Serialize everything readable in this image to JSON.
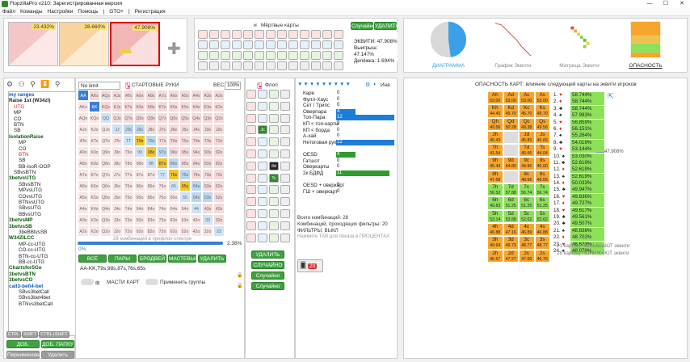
{
  "app": {
    "title": "FlopzillaPro v210: Зарегистрированная версия",
    "min": "—",
    "max": "☐",
    "close": "✕"
  },
  "menu": {
    "items": [
      "Файл",
      "Команды",
      "Настройки",
      "Помощь",
      "|",
      "GTO+",
      "|",
      "Регистрация"
    ]
  },
  "thumbs": [
    {
      "pct": "23.432%"
    },
    {
      "pct": "28.660%"
    },
    {
      "pct": "47.908%"
    }
  ],
  "top_deck": {
    "title": "Мёртвые карты",
    "random_label": "Случайно",
    "delete_label": "УДАЛИТЬ"
  },
  "equity": {
    "line1": "ЭКВИТИ: 47.908%",
    "line2": "Выигрыш: 47.147%",
    "line3": "Делёжка: 1.694%"
  },
  "tabs": [
    {
      "label": "ДИАГРАММА"
    },
    {
      "label": "График Эквити"
    },
    {
      "label": "Матрица Эквити"
    },
    {
      "label": "ОПАСНОСТЬ"
    }
  ],
  "pie": {
    "value": 0.47908,
    "color": "#3aa0e8"
  },
  "range_panel": {
    "mode_select": "No limit",
    "start_hands_label": "СТАРТОВЫЕ РУКИ",
    "weight_label": "ВЕС:",
    "weight_value": "100%",
    "combo_note": "28 комбинаций в префлоп-спектре",
    "pct_low": "0%",
    "pct_high": "2.38%",
    "buttons": [
      "ВСЁ",
      "ПАРЫ",
      "БРОДВЕЙ",
      "МАСТЕВЫЕ",
      "УДАЛИТЬ"
    ],
    "range_text": "AA-KK,T9s,98s,87s,76s,65s",
    "suits_label": "МАСТИ КАРТ",
    "apply_groups_label": "Применить группы"
  },
  "hand_grid": {
    "ranks": [
      "A",
      "K",
      "Q",
      "J",
      "T",
      "9",
      "8",
      "7",
      "6",
      "5",
      "4",
      "3",
      "2"
    ],
    "selected": [
      "AA",
      "KK",
      "T9s",
      "98s",
      "87s",
      "76s",
      "65s"
    ]
  },
  "tree": {
    "items": [
      {
        "t": "my ranges",
        "s": "head-blue"
      },
      {
        "t": "Raise 1st (W34zl)",
        "s": "bold"
      },
      {
        "t": "UTG",
        "s": "red",
        "i": 1
      },
      {
        "t": "MP",
        "s": "",
        "i": 1
      },
      {
        "t": "CO",
        "s": "",
        "i": 1
      },
      {
        "t": "BTN",
        "s": "",
        "i": 1
      },
      {
        "t": "SB",
        "s": "",
        "i": 1
      },
      {
        "t": "IsolationRaise",
        "s": "head"
      },
      {
        "t": "MP",
        "s": "",
        "i": 2
      },
      {
        "t": "CO",
        "s": "",
        "i": 2
      },
      {
        "t": "BTN",
        "s": "red",
        "i": 2
      },
      {
        "t": "SB",
        "s": "",
        "i": 2
      },
      {
        "t": "BB-IsoR-OOP",
        "s": "",
        "i": 2
      },
      {
        "t": "SBvsBTN",
        "s": "",
        "i": 1
      },
      {
        "t": "3betvsUTG",
        "s": "head"
      },
      {
        "t": "SBvsBTN",
        "s": "",
        "i": 2
      },
      {
        "t": "MPvsUTG",
        "s": "",
        "i": 2
      },
      {
        "t": "COvsUTG",
        "s": "",
        "i": 2
      },
      {
        "t": "BTNvsUTG",
        "s": "",
        "i": 2
      },
      {
        "t": "SBvsUTG",
        "s": "",
        "i": 2
      },
      {
        "t": "BBvsUTG",
        "s": "",
        "i": 2
      },
      {
        "t": "3betvsMP",
        "s": "head"
      },
      {
        "t": "3betvsSB",
        "s": "head"
      },
      {
        "t": "3beBBtvsSB",
        "s": "",
        "i": 2
      },
      {
        "t": "W34ZlLCC",
        "s": "head"
      },
      {
        "t": "MP-cc-UTG",
        "s": "",
        "i": 2
      },
      {
        "t": "CO-cc-UTG",
        "s": "",
        "i": 2
      },
      {
        "t": "BTN-cc-UTG",
        "s": "",
        "i": 2
      },
      {
        "t": "BB-cc-UTG",
        "s": "",
        "i": 2
      },
      {
        "t": "Chartsfor5Go",
        "s": "head"
      },
      {
        "t": "3betvsBTN",
        "s": "head"
      },
      {
        "t": "3betvsCO",
        "s": "head"
      },
      {
        "t": "call3-bet\\4-bet",
        "s": "head-blue"
      },
      {
        "t": "SBvs3betCall",
        "s": "",
        "i": 2
      },
      {
        "t": "SBvs3bet4bet",
        "s": "",
        "i": 2
      },
      {
        "t": "BTNvs3betCall",
        "s": "",
        "i": 2
      }
    ],
    "ctrl": [
      "CTRL",
      "SHIFT",
      "CTRL+SHIFT"
    ],
    "add_range": "ДОБ. СПЕКТР",
    "add_folder": "ДОБ. ПАПКУ",
    "rename": "Переименовать",
    "delete": "Удалить"
  },
  "flop": {
    "title": "Флоп",
    "inv": "Инв",
    "board": [
      "Jc",
      "8d",
      "Tc"
    ]
  },
  "flop_buttons": {
    "delete": "УДАЛИТЬ",
    "random": "СЛУЧАЙНО",
    "random_t": "Случайно (T)",
    "random_r": "Случайно (R)"
  },
  "stats": {
    "rows": [
      {
        "l": "Каре",
        "v": "0"
      },
      {
        "l": "Фулл-Хаус",
        "v": "0"
      },
      {
        "l": "Сет / Трипс",
        "v": "0"
      },
      {
        "l": "Оверпара",
        "v": "4",
        "bar": "b"
      },
      {
        "l": "Топ-Пара",
        "v": "12",
        "bar": "b"
      },
      {
        "l": "КП < топ-карты",
        "v": "0"
      },
      {
        "l": "КП < борда",
        "v": "0"
      },
      {
        "l": "А-хай",
        "v": "0"
      },
      {
        "l": "Нетоговая рука",
        "v": "12",
        "bar": "b"
      },
      {
        "l": "",
        "v": ""
      },
      {
        "l": "OESD",
        "v": "4",
        "bar": "g"
      },
      {
        "l": "Гатшот",
        "v": "0"
      },
      {
        "l": "Оверкарты",
        "v": "0"
      },
      {
        "l": "2к БДФД",
        "v": "11",
        "bar": "g"
      },
      {
        "l": "",
        "v": ""
      },
      {
        "l": "OESD + оверкарт",
        "v": "0"
      },
      {
        "l": "ГШ + оверкарт",
        "v": "0"
      }
    ],
    "total": "Всего комбинаций: 28",
    "passed": "Комбинаций, проходящих фильтры: 20",
    "filters": "ФИЛЬТРЫ: ВЫКЛ",
    "hint": "Нажмите TAB для показа в ПРОЦЕНТАХ",
    "badge": "20"
  },
  "danger": {
    "title": "ОПАСНОСТЬ КАРТ: влияние следующей карты на эквити игроков",
    "up": "21 карт(ы) ПОВЫШАЮТ эквити",
    "down": "28 карт(ы) ПОНИЖАЮТ эквити",
    "line_value": "47.908%"
  },
  "danger_grid": [
    [
      "Ah",
      "Ad",
      "Ac",
      "As"
    ],
    [
      "Kh",
      "Kd",
      "Kc",
      "Ks"
    ],
    [
      "Qh",
      "Qd",
      "Qc",
      "Qs"
    ],
    [
      "Jh",
      "",
      "Jd",
      "Js"
    ],
    [
      "Th",
      "",
      "Td",
      "Ts"
    ],
    [
      "9h",
      "9d",
      "9c",
      "9s"
    ],
    [
      "8h",
      "",
      "8c",
      "8s"
    ],
    [
      "7h",
      "7d",
      "7c",
      "7s"
    ],
    [
      "6h",
      "6d",
      "6c",
      "6s"
    ],
    [
      "5h",
      "5d",
      "5c",
      "5s"
    ],
    [
      "4h",
      "4d",
      "4c",
      "4s"
    ],
    [
      "3h",
      "3d",
      "3c",
      "3s"
    ],
    [
      "2h",
      "2d",
      "2c",
      "2s"
    ]
  ],
  "danger_vals": [
    [
      "53.00",
      "53.00",
      "53.00",
      "53.00"
    ],
    [
      "44.40",
      "45.70",
      "45.70",
      "45.70"
    ],
    [
      "49.56",
      "50.28",
      "49.38",
      "49.56"
    ],
    [
      "45.43",
      "",
      "45.83",
      "45.83"
    ],
    [
      "41.54",
      "",
      "45.66",
      "44.04"
    ],
    [
      "45.43",
      "44.80",
      "44.96",
      "45.00"
    ],
    [
      "47.68",
      "",
      "48.66",
      "48.66"
    ],
    [
      "56.52",
      "57.88",
      "56.74",
      "56.74"
    ],
    [
      "49.83",
      "51.25",
      "51.25",
      "51.25"
    ],
    [
      "53.14",
      "53.88",
      "52.62",
      "52.62"
    ],
    [
      "46.88",
      "47.16",
      "46.89",
      "46.88"
    ],
    [
      "49.64",
      "49.73",
      "48.77",
      "48.77"
    ],
    [
      "46.67",
      "47.27",
      "47.00",
      "46.76"
    ]
  ],
  "danger_colors": [
    [
      "#f7a52e",
      "#f7a52e",
      "#f7a52e",
      "#f7a52e"
    ],
    [
      "#f7a52e",
      "#f7a52e",
      "#f7a52e",
      "#f7a52e"
    ],
    [
      "#f7a52e",
      "#f7a52e",
      "#f7a52e",
      "#f7a52e"
    ],
    [
      "#f7a52e",
      "#dddddd",
      "#f7a52e",
      "#f7a52e"
    ],
    [
      "#f7a52e",
      "#dddddd",
      "#f7a52e",
      "#f7a52e"
    ],
    [
      "#f7a52e",
      "#f7a52e",
      "#f7a52e",
      "#f7a52e"
    ],
    [
      "#f7a52e",
      "#dddddd",
      "#f7a52e",
      "#f7a52e"
    ],
    [
      "#8de05a",
      "#8de05a",
      "#8de05a",
      "#8de05a"
    ],
    [
      "#8de05a",
      "#8de05a",
      "#8de05a",
      "#8de05a"
    ],
    [
      "#8de05a",
      "#8de05a",
      "#8de05a",
      "#8de05a"
    ],
    [
      "#f7a52e",
      "#f7a52e",
      "#f7a52e",
      "#f7a52e"
    ],
    [
      "#f7a52e",
      "#f7a52e",
      "#f7a52e",
      "#f7a52e"
    ],
    [
      "#f7a52e",
      "#f7a52e",
      "#f7a52e",
      "#f7a52e"
    ]
  ],
  "ranking": [
    {
      "n": "1.",
      "c": "♥",
      "v": "58.744%",
      "col": "#8de05a"
    },
    {
      "n": "2.",
      "c": "♦",
      "v": "58.744%",
      "col": "#8de05a"
    },
    {
      "n": "3.",
      "c": "♣",
      "v": "58.744%",
      "col": "#8de05a"
    },
    {
      "n": "4.",
      "c": "♠",
      "v": "57.983%",
      "col": "#8de05a"
    },
    {
      "n": "5.",
      "c": "♥",
      "v": "56.859%",
      "col": "#8de05a"
    },
    {
      "n": "6.",
      "c": "♦",
      "v": "56.151%",
      "col": "#8de05a"
    },
    {
      "n": "7.",
      "c": "♠",
      "v": "55.264%",
      "col": "#8de05a"
    },
    {
      "n": "8.",
      "c": "♣",
      "v": "54.019%",
      "col": "#8de05a"
    },
    {
      "n": "9.",
      "c": "♥",
      "v": "53.144%",
      "col": "#8de05a"
    },
    {
      "n": "10.",
      "c": "♠",
      "v": "53.030%",
      "col": "#8de05a"
    },
    {
      "n": "11.",
      "c": "♣",
      "v": "52.619%",
      "col": "#8de05a"
    },
    {
      "n": "12.",
      "c": "♦",
      "v": "52.619%",
      "col": "#8de05a"
    },
    {
      "n": "13.",
      "c": "♠",
      "v": "52.619%",
      "col": "#8de05a"
    },
    {
      "n": "14.",
      "c": "♦",
      "v": "50.033%",
      "col": "#8de05a"
    },
    {
      "n": "15.",
      "c": "♣",
      "v": "49.947%",
      "col": "#8de05a"
    },
    {
      "n": "16.",
      "c": "♥",
      "v": "49.836%",
      "col": "#8de05a"
    },
    {
      "n": "17.",
      "c": "♦",
      "v": "49.727%",
      "col": "#8de05a"
    },
    {
      "n": "18.",
      "c": "♥",
      "v": "49.617%",
      "col": "#8de05a"
    },
    {
      "n": "19.",
      "c": "♣",
      "v": "49.561%",
      "col": "#8de05a"
    },
    {
      "n": "20.",
      "c": "♣",
      "v": "49.507%",
      "col": "#8de05a"
    },
    {
      "n": "21.",
      "c": "♠",
      "v": "48.838%",
      "col": "#8de05a"
    },
    {
      "n": "22.",
      "c": "♦",
      "v": "48.702%",
      "col": "#8de05a"
    },
    {
      "n": "23.",
      "c": "♥",
      "v": "48.673%",
      "col": "#8de05a"
    },
    {
      "n": "24.",
      "c": "♠",
      "v": "48.079%",
      "col": "#8de05a"
    }
  ]
}
